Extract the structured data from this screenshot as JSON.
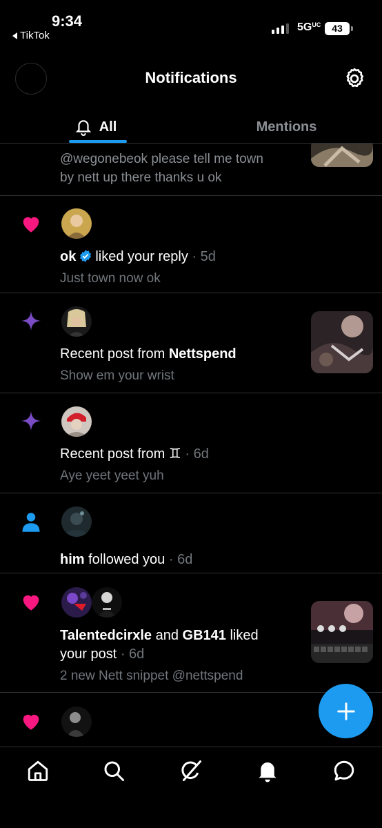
{
  "status_bar": {
    "time": "9:34",
    "back_app": "TikTok",
    "network": "5G",
    "battery": "43"
  },
  "header": {
    "title": "Notifications"
  },
  "tabs": [
    {
      "label": "All",
      "selected": true
    },
    {
      "label": "Mentions",
      "selected": false
    }
  ],
  "notifications": [
    {
      "type": "reply-cutoff",
      "text_line1": "@wegonebeok please tell me town",
      "text_line2": "by nett up there thanks u ok"
    },
    {
      "type": "like",
      "icon": "heart-icon",
      "actor": "ok",
      "verified": true,
      "action": "liked your reply",
      "time": "· 5d",
      "snippet": "Just town now ok"
    },
    {
      "type": "recent-post",
      "icon": "sparkle-icon",
      "prefix": "Recent post from",
      "actor": "Nettspend",
      "snippet": "Show em your wrist"
    },
    {
      "type": "recent-post",
      "icon": "sparkle-icon",
      "prefix": "Recent post from",
      "actor": "♊",
      "time": "· 6d",
      "snippet": "Aye yeet yeet yuh"
    },
    {
      "type": "follow",
      "icon": "person-icon",
      "actor": "him",
      "action": "followed you",
      "time": "· 6d"
    },
    {
      "type": "like",
      "icon": "heart-icon",
      "actor": "Talentedcirxle",
      "conj": "and",
      "actor2": "GB141",
      "action_line1": "liked",
      "action_line2": "your post",
      "time": "· 6d",
      "snippet": "2 new Nett snippet @nettspend"
    },
    {
      "type": "like",
      "icon": "heart-icon"
    }
  ],
  "colors": {
    "accent": "#1d9bf0",
    "heart": "#f91880",
    "sparkle": "#794bc4",
    "secondary_text": "#71767b",
    "divider": "#2f3336"
  },
  "bottom_nav": [
    {
      "name": "home",
      "icon": "home-icon"
    },
    {
      "name": "search",
      "icon": "search-icon"
    },
    {
      "name": "grok",
      "icon": "grok-icon"
    },
    {
      "name": "notifications",
      "icon": "bell-icon"
    },
    {
      "name": "messages",
      "icon": "message-icon"
    }
  ]
}
